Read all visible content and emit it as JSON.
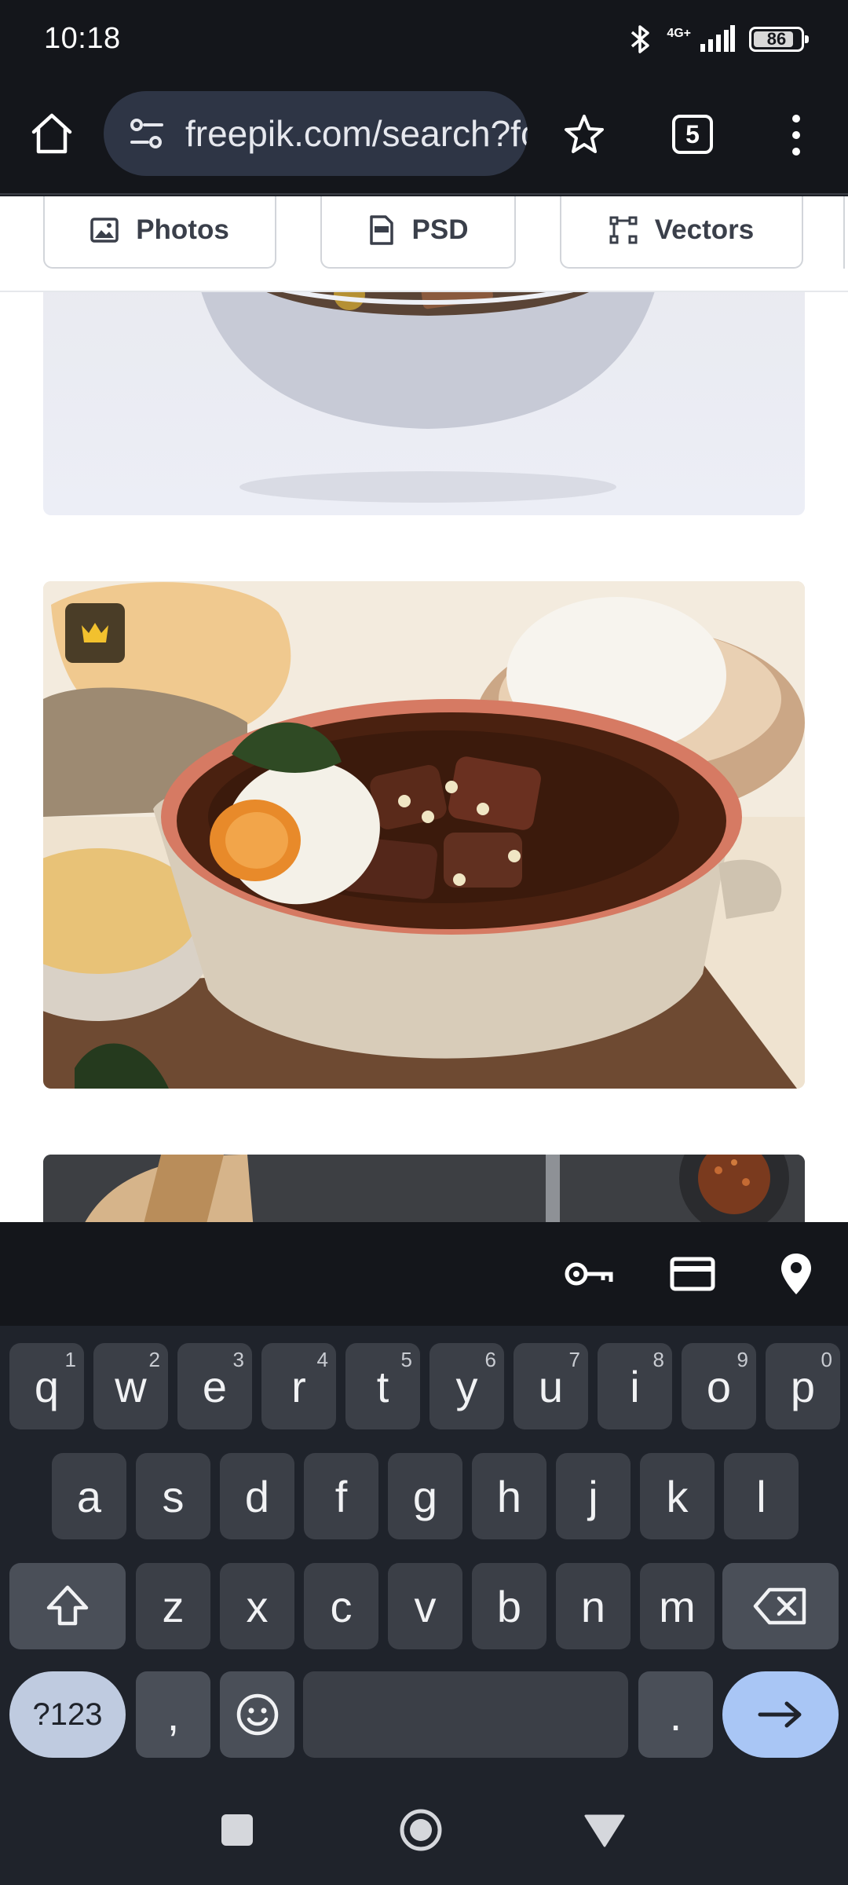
{
  "status_bar": {
    "time": "10:18",
    "network": "4G+",
    "battery": "86",
    "battery_level_percent": 86
  },
  "browser": {
    "url": "freepik.com/search?fo",
    "tab_count": "5",
    "icons": [
      "home-icon",
      "site-settings-icon",
      "bookmark-star-icon",
      "tabs-icon",
      "more-menu-icon"
    ]
  },
  "filters": {
    "photos_label": "Photos",
    "psd_label": "PSD",
    "vectors_label": "Vectors"
  },
  "keyboard": {
    "row1": [
      {
        "key": "q",
        "hint": "1"
      },
      {
        "key": "w",
        "hint": "2"
      },
      {
        "key": "e",
        "hint": "3"
      },
      {
        "key": "r",
        "hint": "4"
      },
      {
        "key": "t",
        "hint": "5"
      },
      {
        "key": "y",
        "hint": "6"
      },
      {
        "key": "u",
        "hint": "7"
      },
      {
        "key": "i",
        "hint": "8"
      },
      {
        "key": "o",
        "hint": "9"
      },
      {
        "key": "p",
        "hint": "0"
      }
    ],
    "row2": [
      "a",
      "s",
      "d",
      "f",
      "g",
      "h",
      "j",
      "k",
      "l"
    ],
    "row3": [
      "z",
      "x",
      "c",
      "v",
      "b",
      "n",
      "m"
    ],
    "symbols_label": "?123",
    "comma": ",",
    "period": ".",
    "suggestion_icons": [
      "key-icon",
      "credit-card-icon",
      "location-pin-icon"
    ]
  },
  "colors": {
    "keyboard_bg": "#1f232b",
    "key_bg": "#3b3f47",
    "enter_key": "#a9c6f5",
    "toolbar_bg": "#14161b",
    "premium_badge": "#f2c12e"
  }
}
